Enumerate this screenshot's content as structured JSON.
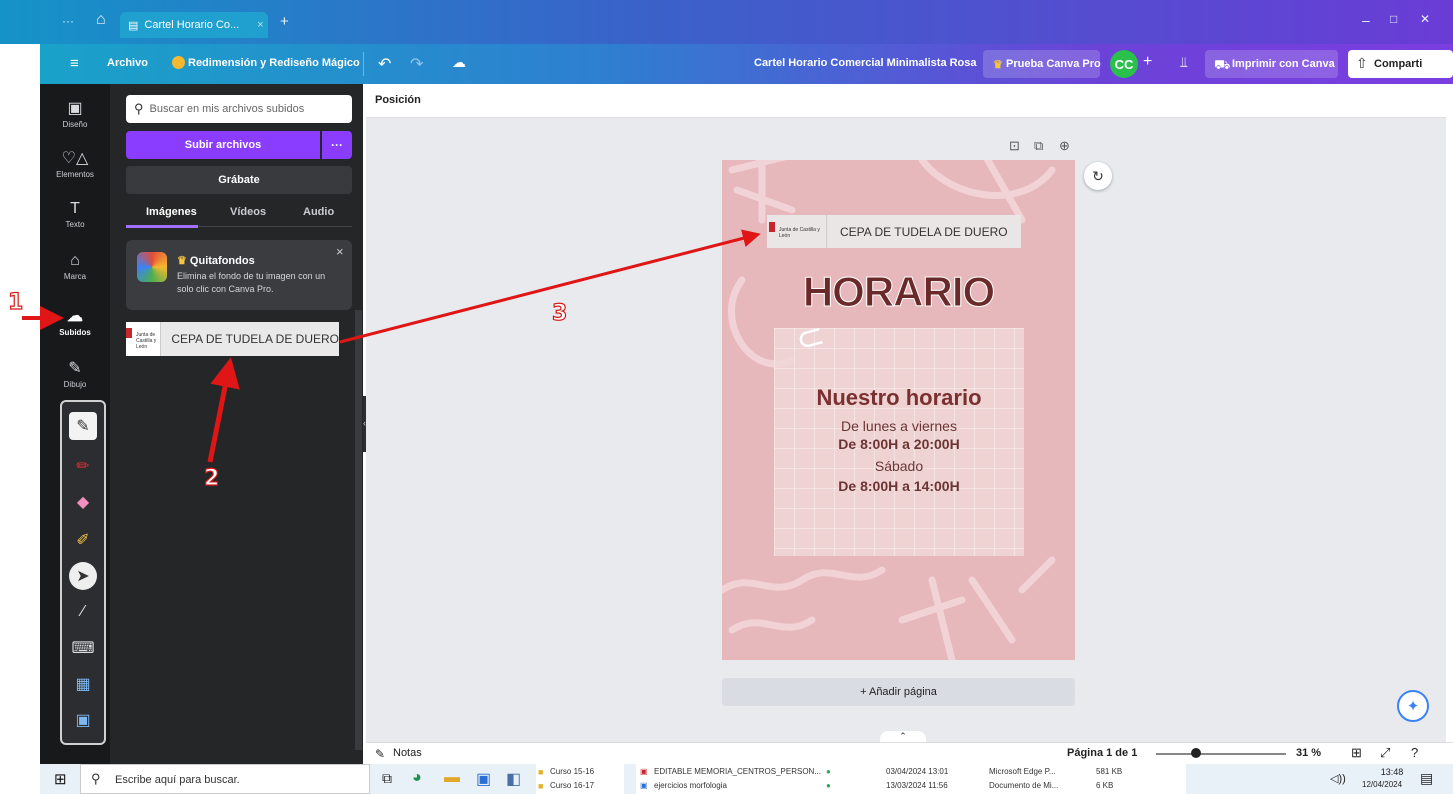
{
  "browser": {
    "tab_title": "Cartel Horario Co...",
    "tab_close": "×",
    "new_tab": "+",
    "menu_dots": "···",
    "window_min": "–",
    "window_max": "□",
    "window_close": "✕"
  },
  "toolbar": {
    "menu": "≡",
    "archivo": "Archivo",
    "magic": "Redimensión y Rediseño Mágico",
    "doc_title": "Cartel Horario Comercial Minimalista Rosa",
    "pro": "Prueba Canva Pro",
    "avatar": "CC",
    "plus": "+",
    "print": "Imprimir con Canva",
    "share": "Comparti"
  },
  "rail": {
    "items": [
      {
        "label": "Diseño",
        "icon": "▣"
      },
      {
        "label": "Elementos",
        "icon": "♡△"
      },
      {
        "label": "Texto",
        "icon": "T"
      },
      {
        "label": "Marca",
        "icon": "⌂"
      },
      {
        "label": "Subidos",
        "icon": "☁"
      },
      {
        "label": "Dibujo",
        "icon": "✎"
      }
    ]
  },
  "panel": {
    "search_placeholder": "Buscar en mis archivos subidos",
    "upload": "Subir archivos",
    "upload_more": "···",
    "grabate": "Grábate",
    "tabs": [
      "Imágenes",
      "Vídeos",
      "Audio"
    ],
    "promo_title": "Quitafondos",
    "promo_body": "Elimina el fondo de tu imagen con un solo clic con Canva Pro.",
    "promo_close": "×",
    "uploaded_text": "CEPA DE TUDELA DE DUERO",
    "uploaded_logo": "Junta de Castilla y León"
  },
  "workspace": {
    "position_label": "Posición",
    "add_page": "+ Añadir página",
    "notes": "Notas",
    "page_indicator": "Página 1 de 1",
    "zoom": "31 %",
    "zoom_fraction": 0.31
  },
  "poster": {
    "header_text": "CEPA DE TUDELA DE DUERO",
    "header_logo": "Junta de Castilla y León",
    "title": "HORARIO",
    "subtitle": "Nuestro horario",
    "line1": "De lunes a viernes",
    "line2": "De 8:00H a 20:00H",
    "line3": "Sábado",
    "line4": "De 8:00H a 14:00H"
  },
  "annotations": {
    "n1": "1",
    "n2": "2",
    "n3": "3"
  },
  "taskbar": {
    "search": "Escribe aquí para buscar.",
    "folders": [
      "Curso 15-16",
      "Curso 16-17"
    ],
    "files": [
      {
        "name": "EDITABLE MEMORIA_CENTROS_PERSON...",
        "date": "03/04/2024 13:01",
        "app": "Microsoft Edge P...",
        "size": "581 KB"
      },
      {
        "name": "ejercicios morfologia",
        "date": "13/03/2024 11:56",
        "app": "Documento de Mi...",
        "size": "6 KB"
      }
    ],
    "time": "13:48",
    "date": "12/04/2024"
  },
  "colors": {
    "accent": "#8b3dff",
    "poster_bg": "#e6b8bc",
    "poster_title": "#6b2a2a",
    "arrow": "#e01616"
  }
}
